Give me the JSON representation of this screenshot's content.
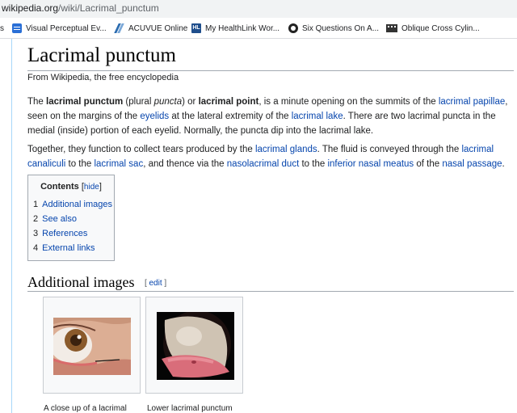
{
  "browser": {
    "url_domain": "wikipedia.org",
    "url_path": "/wiki/Lacrimal_punctum",
    "bookmarks": [
      {
        "label": "s",
        "icon": "none"
      },
      {
        "label": "Visual Perceptual Ev...",
        "icon": "document-icon"
      },
      {
        "label": "ACUVUE Online",
        "icon": "acuvue-logo-icon"
      },
      {
        "label": "My HealthLink Wor...",
        "icon": "healthlink-icon"
      },
      {
        "label": "Six Questions On A...",
        "icon": "six-questions-icon"
      },
      {
        "label": "Oblique Cross Cylin...",
        "icon": "oblique-icon"
      }
    ],
    "hl_icon_text": "HL"
  },
  "article": {
    "title": "Lacrimal punctum",
    "tagline": "From Wikipedia, the free encyclopedia",
    "p1": [
      "The ",
      "lacrimal punctum",
      " (plural ",
      "puncta",
      ") or ",
      "lacrimal point",
      ", is a minute opening on the summits of the ",
      "lacrimal papillae",
      ", seen on the margins of the ",
      "eyelids",
      " at the lateral extremity of the ",
      "lacrimal lake",
      ". There are two lacrimal puncta in the medial (inside) portion of each eyelid. Normally, the puncta dip into the lacrimal lake."
    ],
    "p2": [
      "Together, they function to collect tears produced by the ",
      "lacrimal glands",
      ". The fluid is conveyed through the ",
      "lacrimal canaliculi",
      " to the ",
      "lacrimal sac",
      ", and thence via the ",
      "nasolacrimal duct",
      " to the ",
      "inferior nasal meatus",
      " of the ",
      "nasal passage",
      "."
    ]
  },
  "toc": {
    "title": "Contents",
    "hide_label": "hide",
    "items": [
      {
        "num": "1",
        "label": "Additional images"
      },
      {
        "num": "2",
        "label": "See also"
      },
      {
        "num": "3",
        "label": "References"
      },
      {
        "num": "4",
        "label": "External links"
      }
    ]
  },
  "section": {
    "heading": "Additional images",
    "edit_label": "edit"
  },
  "gallery": [
    {
      "caption": "A close up of a lacrimal"
    },
    {
      "caption": "Lower lacrimal punctum"
    }
  ],
  "colors": {
    "link": "#0645ad",
    "rule": "#a2a9b1",
    "toc_bg": "#f8f9fa"
  }
}
